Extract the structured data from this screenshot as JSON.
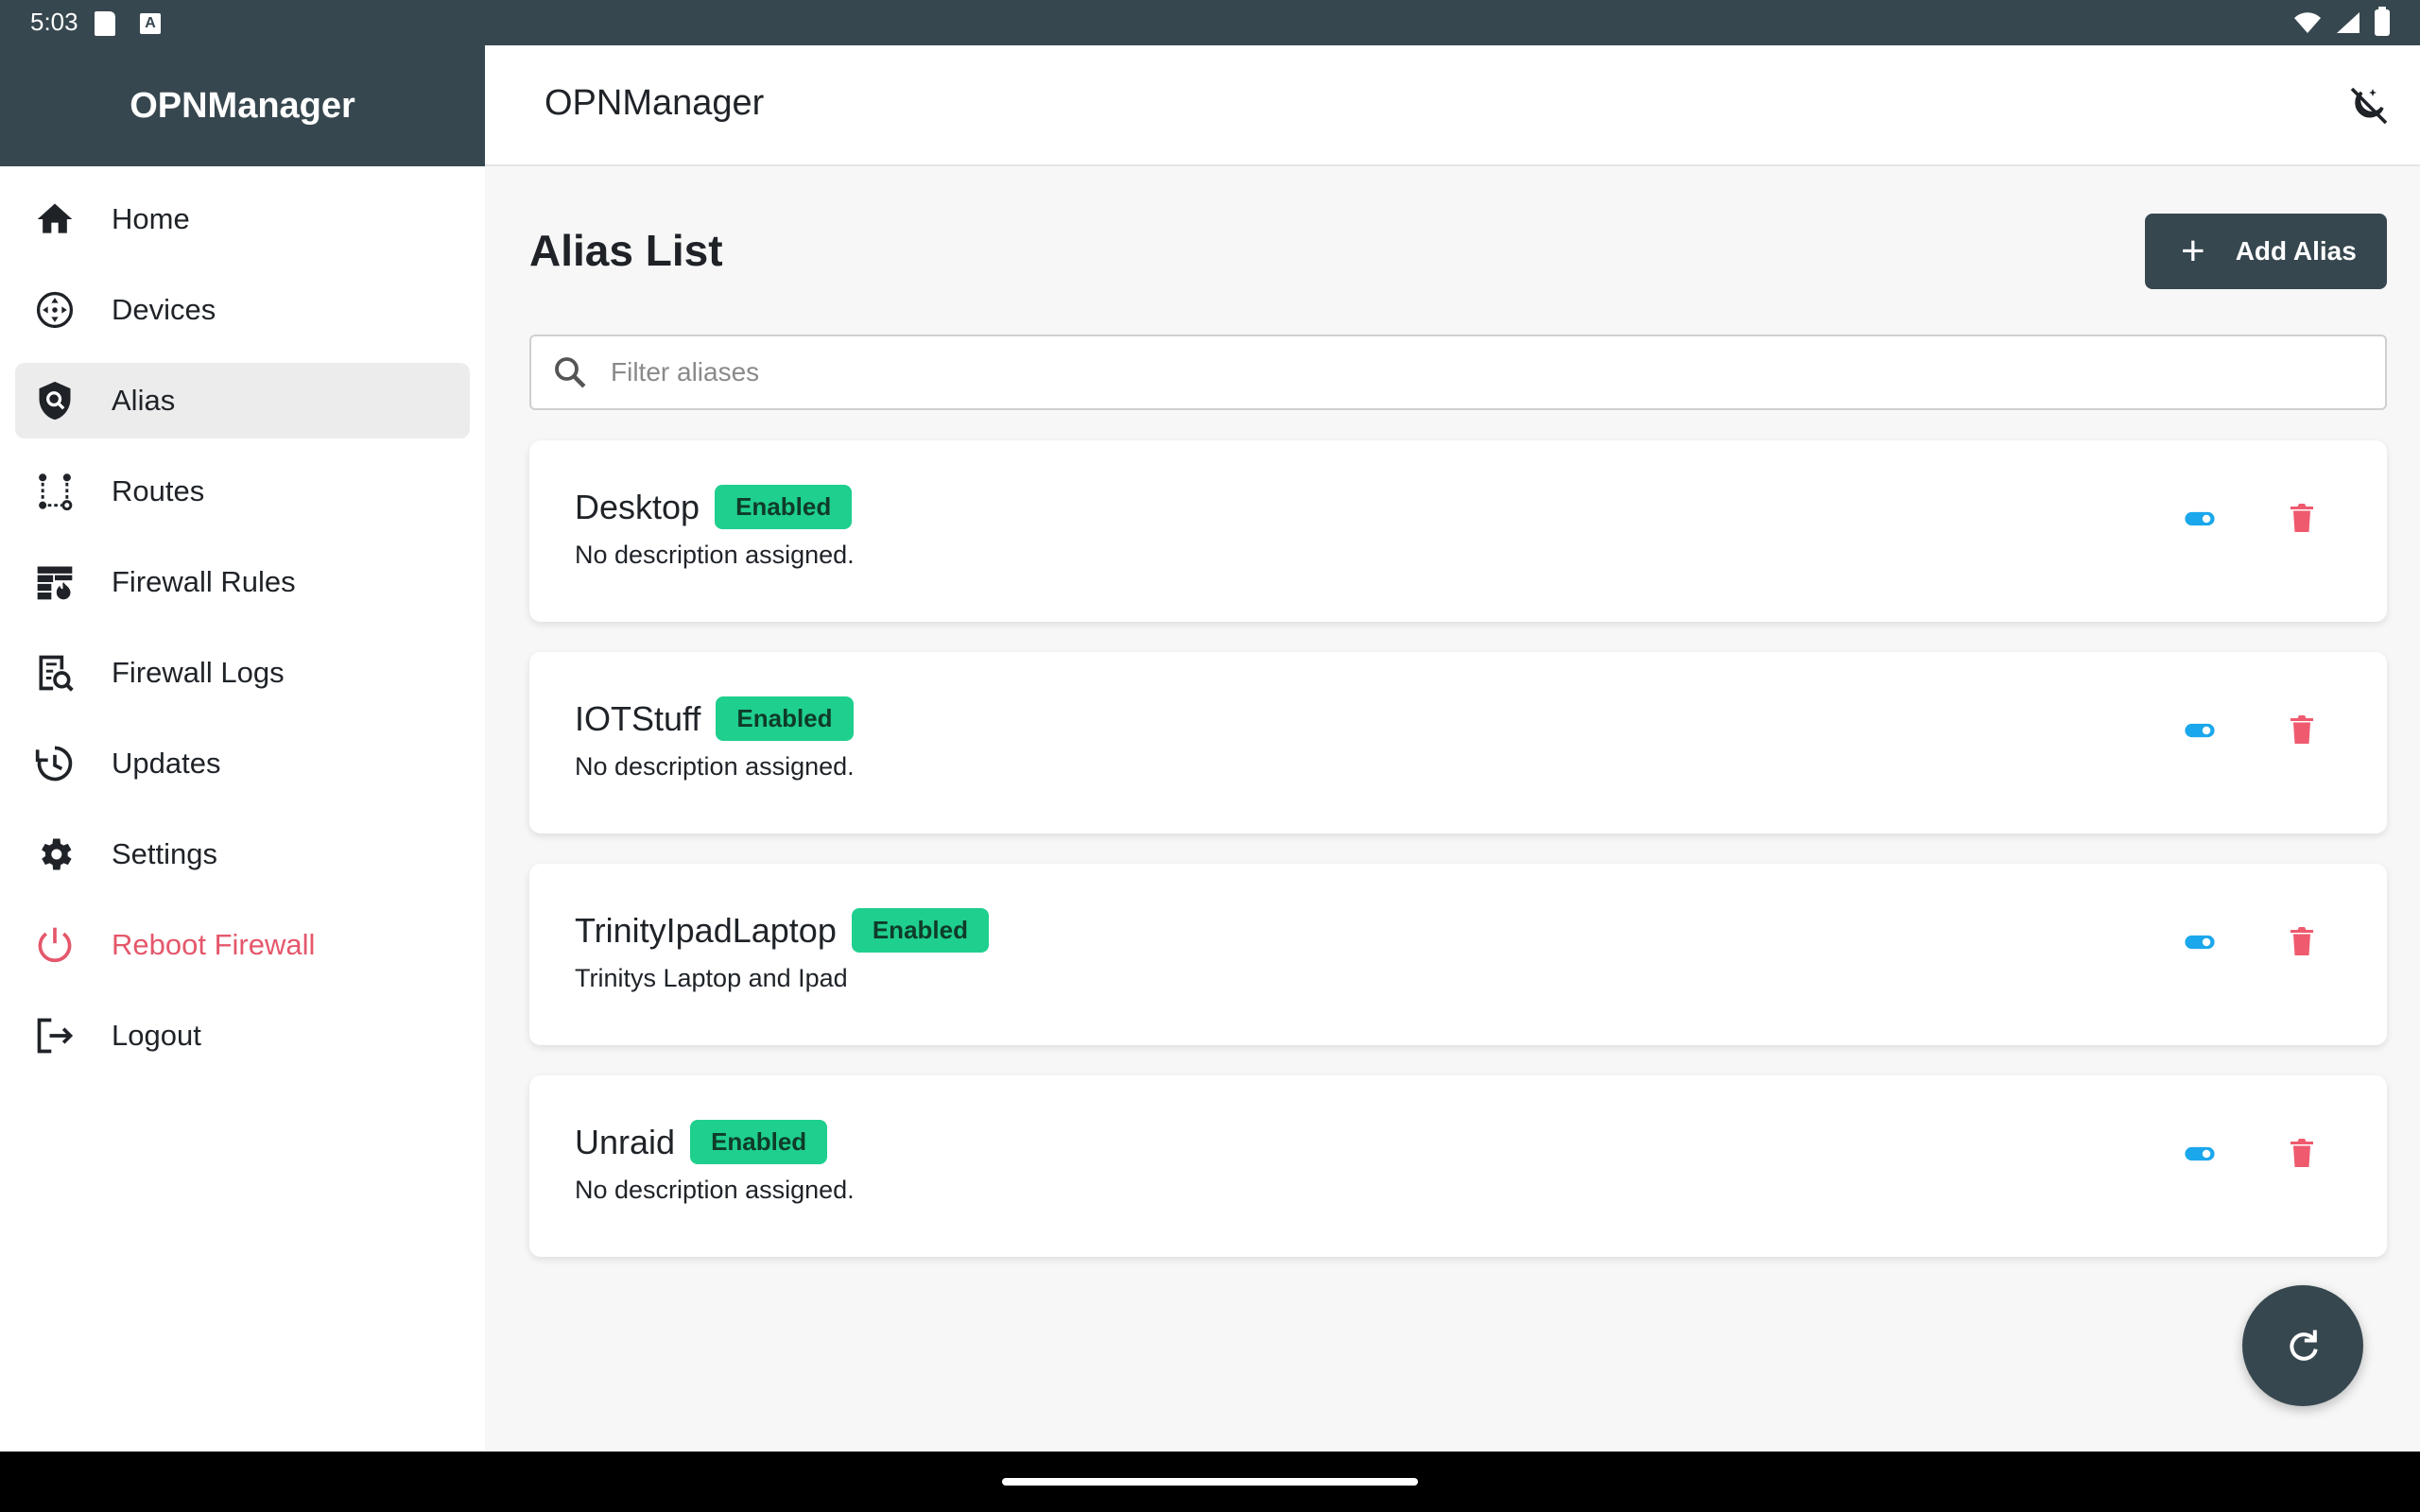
{
  "status": {
    "time": "5:03",
    "notif_letter": "A"
  },
  "app": {
    "title": "OPNManager",
    "drawer_title": "OPNManager"
  },
  "sidebar": {
    "items": [
      {
        "label": "Home",
        "icon": "home-icon"
      },
      {
        "label": "Devices",
        "icon": "devices-icon"
      },
      {
        "label": "Alias",
        "icon": "alias-shield-icon",
        "active": true
      },
      {
        "label": "Routes",
        "icon": "routes-icon"
      },
      {
        "label": "Firewall Rules",
        "icon": "firewall-icon"
      },
      {
        "label": "Firewall Logs",
        "icon": "logs-icon"
      },
      {
        "label": "Updates",
        "icon": "updates-icon"
      },
      {
        "label": "Settings",
        "icon": "settings-icon"
      },
      {
        "label": "Reboot Firewall",
        "icon": "power-icon",
        "danger": true
      },
      {
        "label": "Logout",
        "icon": "logout-icon"
      }
    ]
  },
  "main": {
    "title": "Alias List",
    "add_button": "Add Alias",
    "search_placeholder": "Filter aliases",
    "aliases": [
      {
        "name": "Desktop",
        "status": "Enabled",
        "description": "No description assigned."
      },
      {
        "name": "IOTStuff",
        "status": "Enabled",
        "description": "No description assigned."
      },
      {
        "name": "TrinityIpadLaptop",
        "status": "Enabled",
        "description": "Trinitys Laptop and Ipad"
      },
      {
        "name": "Unraid",
        "status": "Enabled",
        "description": "No description assigned."
      }
    ]
  },
  "colors": {
    "primary": "#37474f",
    "badge": "#1fcf8d",
    "toggle": "#1aa7ec",
    "delete": "#ef5a6f",
    "danger_text": "#e5576b"
  }
}
